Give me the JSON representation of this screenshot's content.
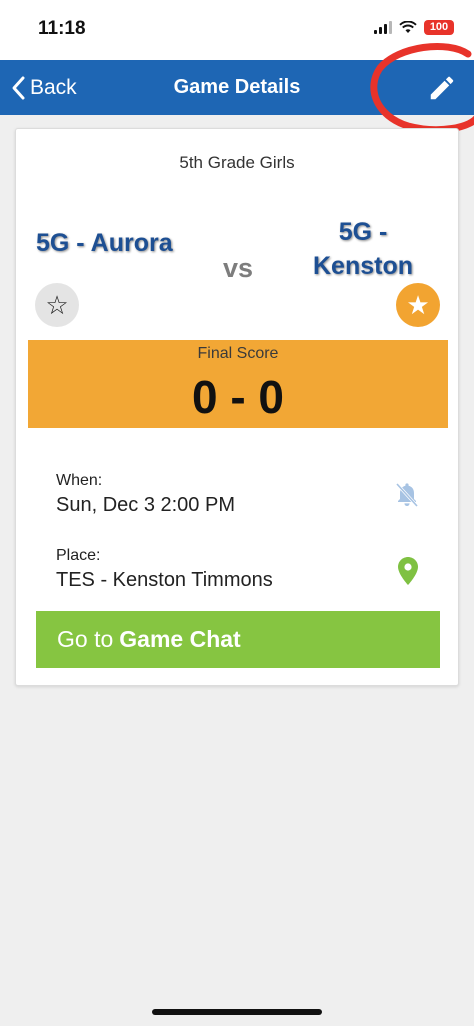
{
  "status_bar": {
    "time": "11:18",
    "battery": "100"
  },
  "nav": {
    "back_label": "Back",
    "title": "Game Details",
    "edit_icon": "pencil-icon"
  },
  "game": {
    "division": "5th Grade Girls",
    "home_team": "5G - Aurora",
    "vs": "vs",
    "away_team_line1": "5G -",
    "away_team_line2": "Kenston",
    "home_favorite_icon": "star-outline-icon",
    "away_favorite_icon": "star-filled-icon"
  },
  "score": {
    "label": "Final Score",
    "value": "0 - 0"
  },
  "when": {
    "label": "When:",
    "value": "Sun, Dec 3 2:00 PM",
    "icon": "bell-off-icon"
  },
  "place": {
    "label": "Place:",
    "value": "TES - Kenston Timmons",
    "icon": "map-pin-icon"
  },
  "chat_button": {
    "prefix": "Go to",
    "emphasis": "Game Chat"
  },
  "colors": {
    "nav_blue": "#1e66b4",
    "team_blue": "#1d4f93",
    "score_orange": "#f2a735",
    "chat_green": "#86c541",
    "annotation_red": "#e8332a"
  }
}
